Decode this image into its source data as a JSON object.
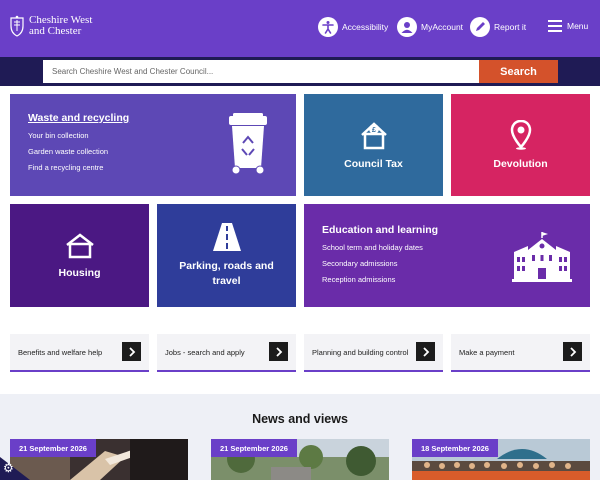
{
  "header": {
    "logo_line1": "Cheshire West",
    "logo_line2": "and Chester",
    "nav": {
      "accessibility": "Accessibility",
      "myaccount": "MyAccount",
      "report": "Report it",
      "menu": "Menu"
    },
    "brand_color": "#6a3fc8"
  },
  "search": {
    "placeholder": "Search Cheshire West and Chester Council...",
    "button": "Search",
    "button_color": "#d4522b"
  },
  "tiles": {
    "waste": {
      "title": "Waste and recycling",
      "links": [
        "Your bin collection",
        "Garden waste collection",
        "Find a recycling centre"
      ],
      "icon": "wheelie-bin-icon"
    },
    "council_tax": {
      "title": "Council Tax",
      "icon": "house-pound-icon"
    },
    "devolution": {
      "title": "Devolution",
      "icon": "map-pin-icon"
    },
    "housing": {
      "title": "Housing",
      "icon": "house-icon"
    },
    "parking": {
      "title": "Parking, roads and travel",
      "icon": "road-icon"
    },
    "education": {
      "title": "Education and learning",
      "links": [
        "School term and holiday dates",
        "Secondary admissions",
        "Reception admissions"
      ],
      "icon": "school-building-icon"
    }
  },
  "quick_links": [
    {
      "label": "Benefits and welfare help"
    },
    {
      "label": "Jobs - search and apply"
    },
    {
      "label": "Planning and building control"
    },
    {
      "label": "Make a payment"
    }
  ],
  "news": {
    "title": "News and views",
    "cards": [
      {
        "date": "21 September 2026"
      },
      {
        "date": "21 September 2026"
      },
      {
        "date": "18 September 2026"
      }
    ]
  }
}
